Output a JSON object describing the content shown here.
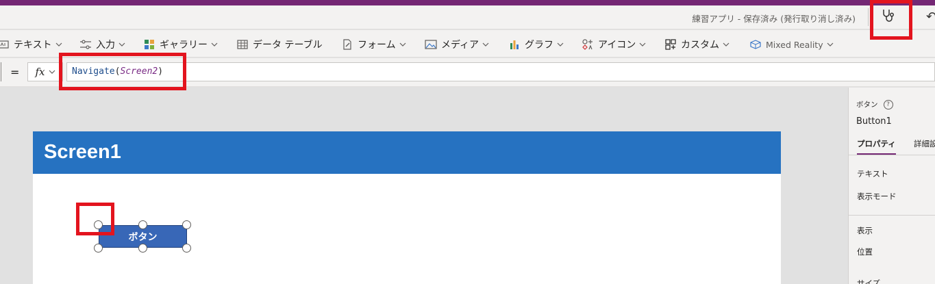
{
  "title_bar": {
    "app_title": "練習アプリ - 保存済み (発行取り消し済み)"
  },
  "insert_toolbar": {
    "items": [
      {
        "label": "テキスト",
        "icon": "text-icon"
      },
      {
        "label": "入力",
        "icon": "input-icon"
      },
      {
        "label": "ギャラリー",
        "icon": "gallery-icon"
      },
      {
        "label": "データ テーブル",
        "icon": "data-table-icon"
      },
      {
        "label": "フォーム",
        "icon": "form-icon"
      },
      {
        "label": "メディア",
        "icon": "media-icon"
      },
      {
        "label": "グラフ",
        "icon": "chart-icon"
      },
      {
        "label": "アイコン",
        "icon": "icons-icon"
      },
      {
        "label": "カスタム",
        "icon": "custom-icon"
      },
      {
        "label": "Mixed Reality",
        "icon": "mixed-reality-icon"
      }
    ]
  },
  "formula_bar": {
    "equals": "=",
    "fx_label": "fx",
    "function_name": "Navigate",
    "open_paren": "(",
    "argument": "Screen2",
    "close_paren": ")"
  },
  "canvas": {
    "screen_title": "Screen1",
    "button_label": "ボタン"
  },
  "properties_panel": {
    "control_type": "ボタン",
    "control_name": "Button1",
    "tabs": [
      "プロパティ",
      "詳細設定"
    ],
    "rows": [
      "テキスト",
      "表示モード",
      "表示",
      "位置",
      "サイズ"
    ]
  },
  "colors": {
    "header_purple": "#742774",
    "screen_header_blue": "#2672c1",
    "button_blue": "#3867b7",
    "highlight_red": "#e3141e"
  }
}
